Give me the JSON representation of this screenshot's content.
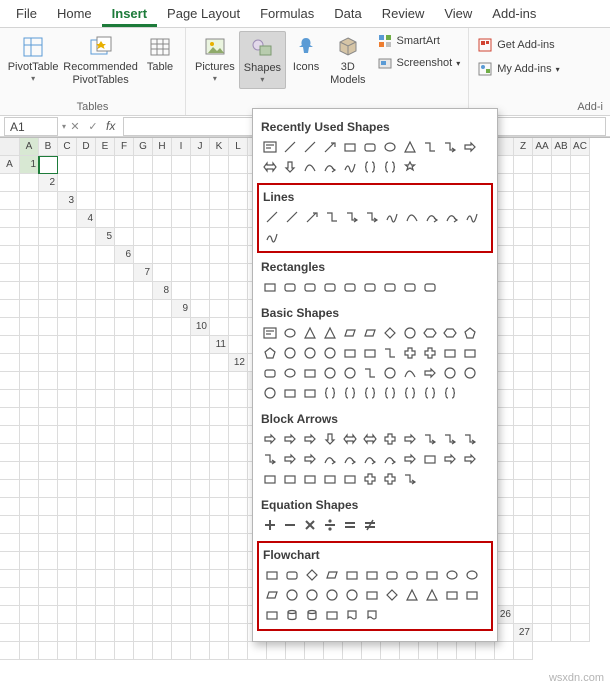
{
  "tabs": [
    "File",
    "Home",
    "Insert",
    "Page Layout",
    "Formulas",
    "Data",
    "Review",
    "View",
    "Add-ins"
  ],
  "active_tab": "Insert",
  "ribbon": {
    "tables": {
      "label": "Tables",
      "pivottable": "PivotTable",
      "recommended1": "Recommended",
      "recommended2": "PivotTables",
      "table": "Table"
    },
    "illustrations": {
      "pictures": "Pictures",
      "shapes": "Shapes",
      "icons": "Icons",
      "models1": "3D",
      "models2": "Models",
      "smartart": "SmartArt",
      "screenshot": "Screenshot"
    },
    "addins": {
      "label": "Add-i",
      "get": "Get Add-ins",
      "my": "My Add-ins"
    }
  },
  "formula_bar": {
    "name": "A1",
    "fx": "fx"
  },
  "columns": [
    "A",
    "B",
    "C",
    "D",
    "E",
    "F",
    "G",
    "H",
    "I",
    "J",
    "K",
    "L",
    "",
    "",
    "",
    "",
    "",
    "",
    "",
    "",
    "",
    "",
    "",
    "",
    "",
    "",
    "Z",
    "AA",
    "AB",
    "AC",
    "A"
  ],
  "row_count": 27,
  "shapes_panel": {
    "recent": "Recently Used Shapes",
    "lines": "Lines",
    "rectangles": "Rectangles",
    "basic": "Basic Shapes",
    "block": "Block Arrows",
    "equation": "Equation Shapes",
    "flowchart": "Flowchart"
  },
  "watermark": "wsxdn.com"
}
